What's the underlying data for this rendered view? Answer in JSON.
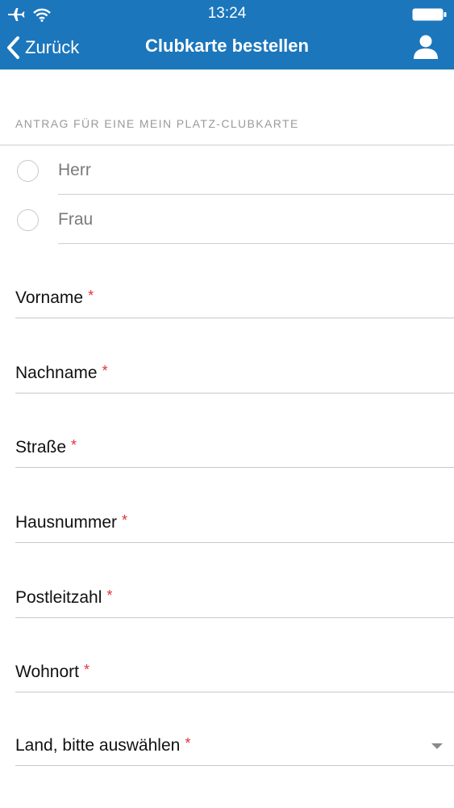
{
  "status_bar": {
    "time": "13:24"
  },
  "nav": {
    "back_label": "Zurück",
    "title": "Clubkarte bestellen"
  },
  "form": {
    "section_header": "ANTRAG FÜR EINE MEIN PLATZ-CLUBKARTE",
    "salutation_options": [
      "Herr",
      "Frau"
    ],
    "required_marker": "*",
    "fields": [
      {
        "label": "Vorname"
      },
      {
        "label": "Nachname"
      },
      {
        "label": "Straße"
      },
      {
        "label": "Hausnummer"
      },
      {
        "label": "Postleitzahl"
      },
      {
        "label": "Wohnort"
      },
      {
        "label": "Land, bitte auswählen"
      }
    ]
  },
  "colors": {
    "header_background": "#1b76bc",
    "required_marker": "#e0343a",
    "section_header_text": "#9a9a9a"
  }
}
